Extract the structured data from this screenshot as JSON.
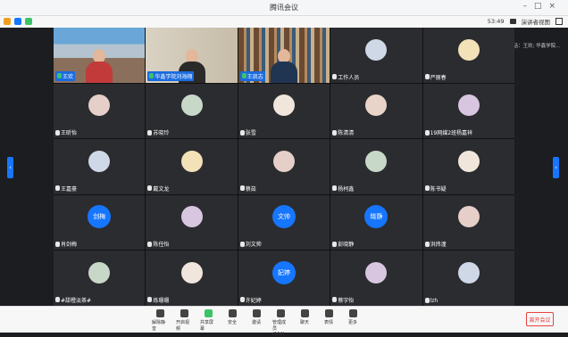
{
  "window": {
    "title": "腾讯会议"
  },
  "infobar": {
    "time": "53:49",
    "view_label": "演讲者视图"
  },
  "speaking": "正在讲话：王欢; 华鑫学院...",
  "colors": {
    "blue": "#1676ff",
    "leave": "#e64340"
  },
  "participants": [
    {
      "name": "王欢",
      "type": "video"
    },
    {
      "name": "华鑫学院刘海翔",
      "type": "video"
    },
    {
      "name": "王凯志",
      "type": "video"
    },
    {
      "name": "工作人员"
    },
    {
      "name": "严丽春"
    },
    {
      "name": "王昕怡"
    },
    {
      "name": "苏晓玲"
    },
    {
      "name": "张雪"
    },
    {
      "name": "陈清清"
    },
    {
      "name": "19网媒2班杨嘉祥"
    },
    {
      "name": "王嘉豪"
    },
    {
      "name": "戴文龙"
    },
    {
      "name": "蔡茹"
    },
    {
      "name": "杨柯鑫"
    },
    {
      "name": "陈书疑"
    },
    {
      "name": "肖剑梅",
      "initials": "剑梅"
    },
    {
      "name": "陈任怡"
    },
    {
      "name": "刘文帅",
      "initials": "文帅"
    },
    {
      "name": "彭晓静",
      "initials": "晓静"
    },
    {
      "name": "洪炜潼"
    },
    {
      "name": "#甜橙淡茶#"
    },
    {
      "name": "练珊珊"
    },
    {
      "name": "许妃婷",
      "initials": "妃婷"
    },
    {
      "name": "蔡宇怡"
    },
    {
      "name": "lzh"
    }
  ],
  "toolbar": [
    {
      "label": "解除静音"
    },
    {
      "label": "开启视频"
    },
    {
      "label": "共享屏幕"
    },
    {
      "label": "安全"
    },
    {
      "label": "邀请"
    },
    {
      "label": "管理成员(164)"
    },
    {
      "label": "聊天"
    },
    {
      "label": "表情"
    },
    {
      "label": "更多"
    }
  ],
  "leave_label": "离开会议"
}
